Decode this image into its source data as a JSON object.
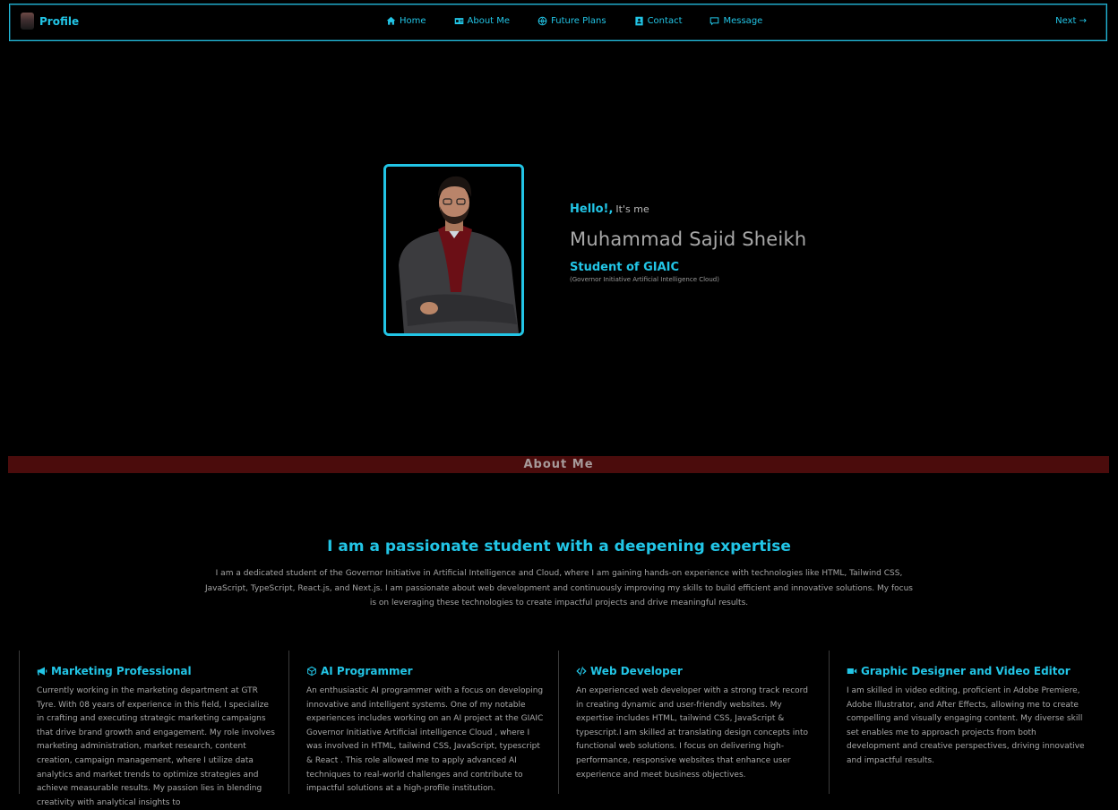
{
  "navbar": {
    "brand": "Profile",
    "links": [
      {
        "label": "Home",
        "icon": "home-icon"
      },
      {
        "label": "About Me",
        "icon": "id-card-icon"
      },
      {
        "label": "Future Plans",
        "icon": "globe-icon"
      },
      {
        "label": "Contact",
        "icon": "contact-book-icon"
      },
      {
        "label": "Message",
        "icon": "message-icon"
      }
    ],
    "next": "Next →"
  },
  "hero": {
    "hello": "Hello!,",
    "its_me": "It's me",
    "name": "Muhammad Sajid Sheikh",
    "role": "Student of GIAIC",
    "role_sub": "(Governor Initiative Artificial Intelligence Cloud)"
  },
  "about": {
    "bar_label": "About Me",
    "title": "I am a passionate student with a deepening expertise",
    "paragraph": "I am a dedicated student of the Governor Initiative in Artificial Intelligence and Cloud, where I am gaining hands-on experience with technologies like HTML, Tailwind CSS, JavaScript, TypeScript, React.js, and Next.js. I am passionate about web development and continuously improving my skills to build efficient and innovative solutions. My focus is on leveraging these technologies to create impactful projects and drive meaningful results."
  },
  "cards": [
    {
      "title": "Marketing Professional",
      "icon": "megaphone-icon",
      "text": "Currently working in the marketing department at GTR Tyre. With 08 years of experience in this field, I specialize in crafting and executing strategic marketing campaigns that drive brand growth and engagement. My role involves marketing administration, market research, content creation, campaign management, where I utilize data analytics and market trends to optimize strategies and achieve measurable results. My passion lies in blending creativity with analytical insights to"
    },
    {
      "title": "AI Programmer",
      "icon": "cube-icon",
      "text": "An enthusiastic AI programmer with a focus on developing innovative and intelligent systems. One of my notable experiences includes working on an AI project at the GIAIC Governor Initiative Artificial intelligence Cloud , where I was involved in HTML, tailwind CSS, JavaScript, typescript & React . This role allowed me to apply advanced AI techniques to real-world challenges and contribute to impactful solutions at a high-profile institution."
    },
    {
      "title": "Web Developer",
      "icon": "code-icon",
      "text": "An experienced web developer with a strong track record in creating dynamic and user-friendly websites. My expertise includes HTML, tailwind CSS, JavaScript & typescript.I am skilled at translating design concepts into functional web solutions. I focus on delivering high-performance, responsive websites that enhance user experience and meet business objectives."
    },
    {
      "title": "Graphic Designer and Video Editor",
      "icon": "video-camera-icon",
      "text": "I am skilled in video editing, proficient in Adobe Premiere, Adobe Illustrator, and After Effects, allowing me to create compelling and visually engaging content. My diverse skill set enables me to approach projects from both development and creative perspectives, driving innovative and impactful results."
    }
  ],
  "colors": {
    "accent": "#22c5e6",
    "about_bar": "#4b0c0c",
    "background": "#000000"
  }
}
